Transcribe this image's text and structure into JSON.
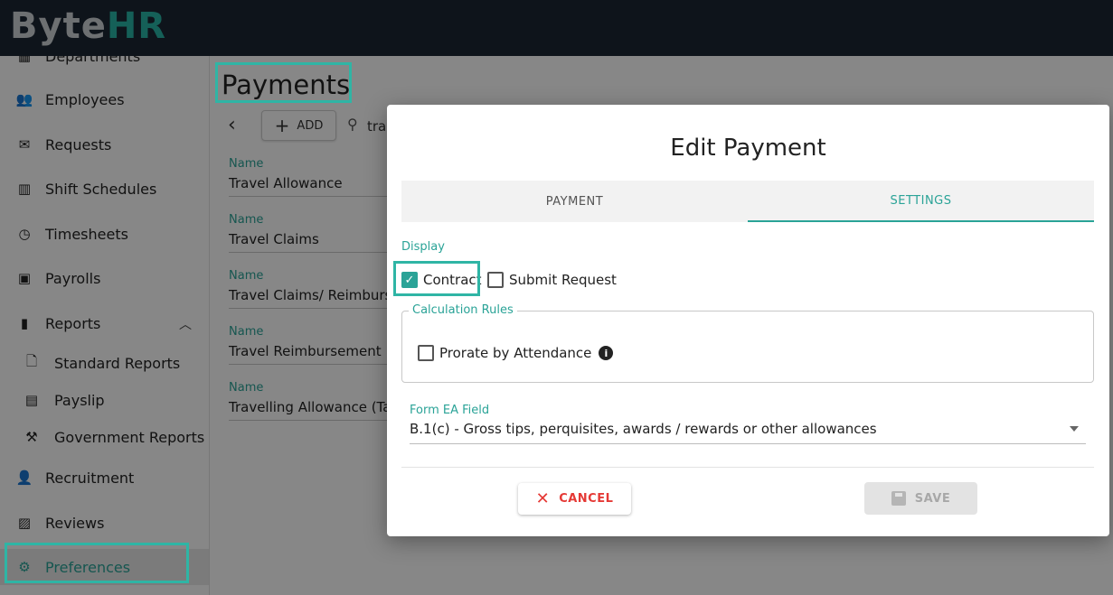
{
  "app": {
    "logo_b": "B",
    "logo_yte": "yte",
    "logo_hr": "HR"
  },
  "sidebar": {
    "items": [
      {
        "label": "Departments",
        "icon": "grid-icon"
      },
      {
        "label": "Employees",
        "icon": "users-icon"
      },
      {
        "label": "Requests",
        "icon": "envelope-icon"
      },
      {
        "label": "Shift Schedules",
        "icon": "calendar-icon"
      },
      {
        "label": "Timesheets",
        "icon": "calendar-clock-icon"
      },
      {
        "label": "Payrolls",
        "icon": "money-icon"
      },
      {
        "label": "Reports",
        "icon": "file-icon"
      },
      {
        "label": "Standard Reports",
        "icon": "document-icon"
      },
      {
        "label": "Payslip",
        "icon": "id-card-icon"
      },
      {
        "label": "Government Reports",
        "icon": "gavel-icon"
      },
      {
        "label": "Recruitment",
        "icon": "user-search-icon"
      },
      {
        "label": "Reviews",
        "icon": "chart-icon"
      },
      {
        "label": "Preferences",
        "icon": "gears-icon"
      }
    ]
  },
  "main": {
    "title": "Payments",
    "add_label": "ADD",
    "search_value": "tra",
    "list": [
      {
        "label": "Name",
        "value": "Travel Allowance"
      },
      {
        "label": "Name",
        "value": "Travel Claims"
      },
      {
        "label": "Name",
        "value": "Travel Claims/ Reimburse"
      },
      {
        "label": "Name",
        "value": "Travel Reimbursement"
      },
      {
        "label": "Name",
        "value": "Travelling Allowance (Tax"
      }
    ]
  },
  "dialog": {
    "title": "Edit Payment",
    "tabs": [
      {
        "label": "PAYMENT"
      },
      {
        "label": "SETTINGS"
      }
    ],
    "display_label": "Display",
    "contract_label": "Contract",
    "contract_checked": true,
    "submit_request_label": "Submit Request",
    "submit_request_checked": false,
    "calc_rules_label": "Calculation Rules",
    "prorate_label": "Prorate by Attendance",
    "prorate_checked": false,
    "form_ea_label": "Form EA Field",
    "form_ea_value": "B.1(c) - Gross tips, perquisites, awards / rewards or other allowances",
    "cancel_label": "CANCEL",
    "save_label": "SAVE"
  },
  "colors": {
    "accent": "#2aa397",
    "topbar": "#1b2634",
    "cancel": "#e53935"
  }
}
